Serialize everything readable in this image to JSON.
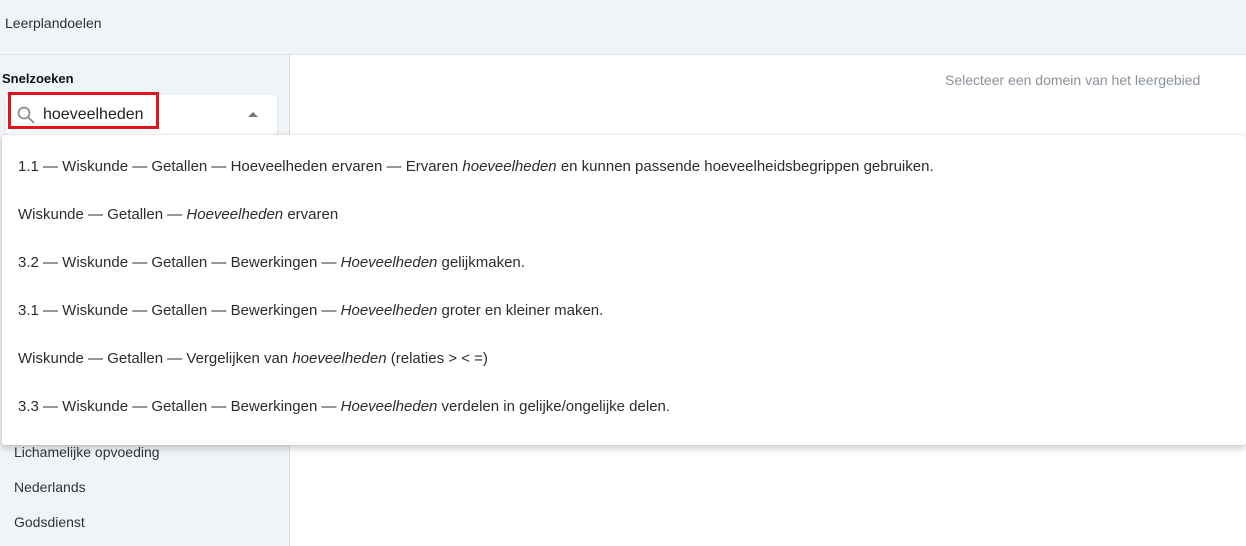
{
  "header": {
    "title": "Leerplandoelen"
  },
  "sidebar": {
    "quick_search_label": "Snelzoeken",
    "search_value": "hoeveelheden",
    "items": [
      "Lichamelijke opvoeding",
      "Nederlands",
      "Godsdienst"
    ]
  },
  "main": {
    "hint": "Selecteer een domein van het leergebied"
  },
  "dropdown": {
    "options": [
      {
        "pre": "1.1 — Wiskunde — Getallen — Hoeveelheden ervaren — Ervaren ",
        "match": "hoeveelheden",
        "post": " en kunnen passende hoeveelheidsbegrippen gebruiken."
      },
      {
        "pre": "Wiskunde — Getallen — ",
        "match": "Hoeveelheden",
        "post": " ervaren"
      },
      {
        "pre": "3.2 — Wiskunde — Getallen — Bewerkingen — ",
        "match": "Hoeveelheden",
        "post": " gelijkmaken."
      },
      {
        "pre": "3.1 — Wiskunde — Getallen — Bewerkingen — ",
        "match": "Hoeveelheden",
        "post": " groter en kleiner maken."
      },
      {
        "pre": "Wiskunde — Getallen — Vergelijken van ",
        "match": "hoeveelheden",
        "post": " (relaties > < =)"
      },
      {
        "pre": "3.3 — Wiskunde — Getallen — Bewerkingen — ",
        "match": "Hoeveelheden",
        "post": " verdelen in gelijke/ongelijke delen."
      }
    ]
  },
  "colors": {
    "highlight_border": "#e3131b",
    "sidebar_bg": "#f1f4f7"
  },
  "icons": {
    "search": "search-icon",
    "caret": "caret-up-icon"
  }
}
